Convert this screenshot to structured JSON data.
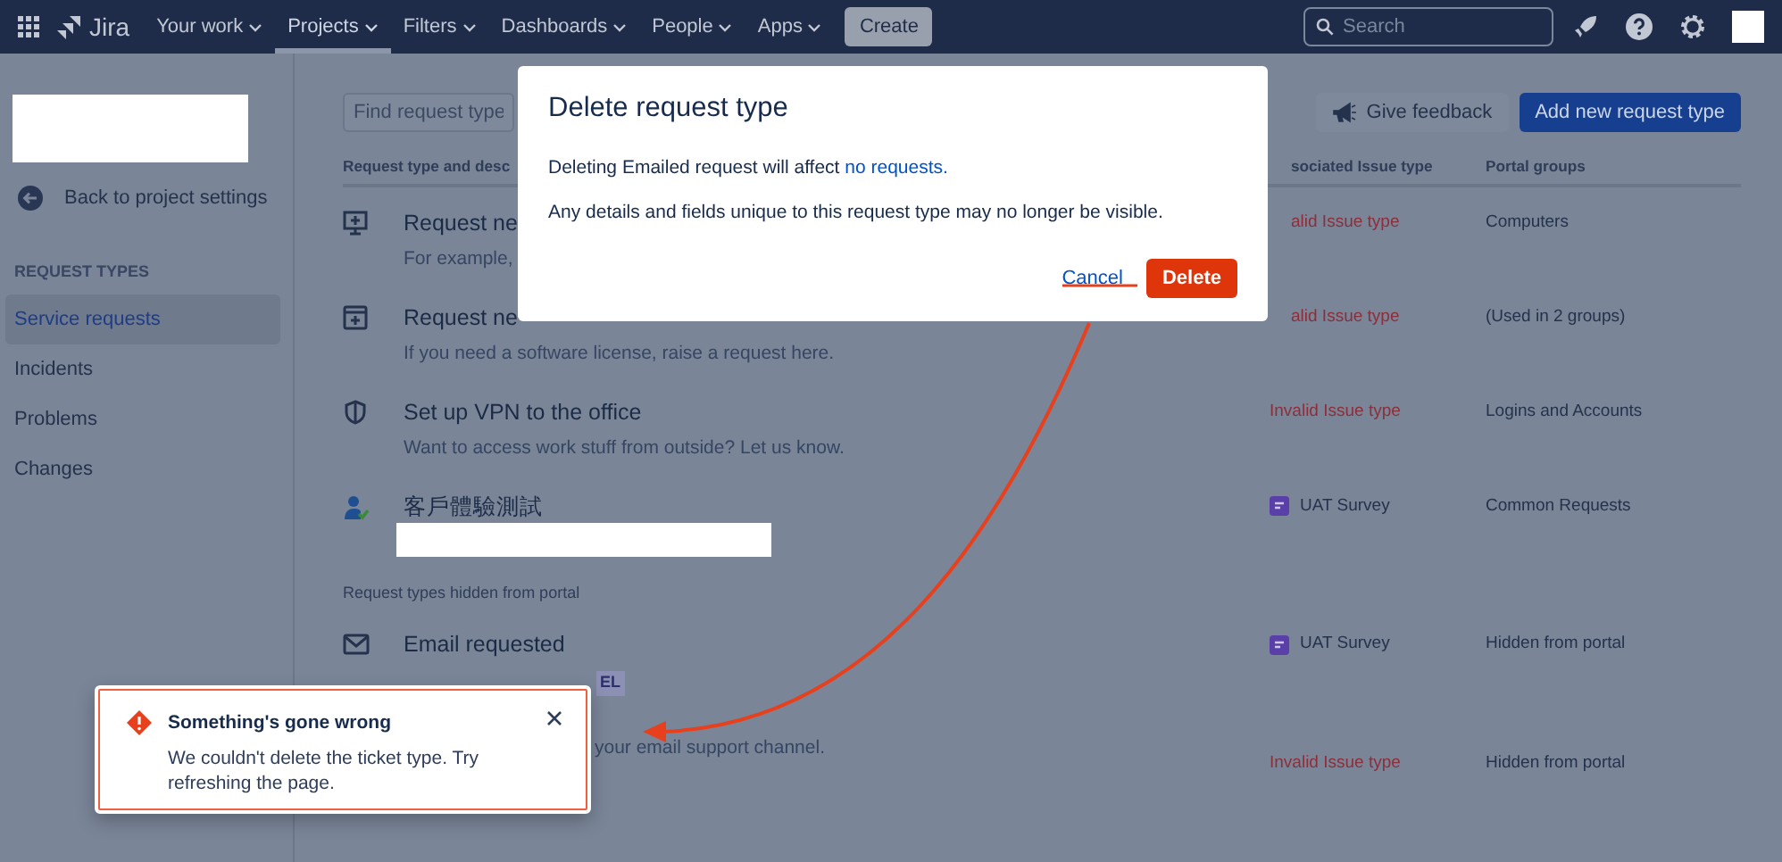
{
  "navbar": {
    "product": "Jira",
    "items": [
      {
        "label": "Your work",
        "selected": false
      },
      {
        "label": "Projects",
        "selected": true
      },
      {
        "label": "Filters",
        "selected": false
      },
      {
        "label": "Dashboards",
        "selected": false
      },
      {
        "label": "People",
        "selected": false
      },
      {
        "label": "Apps",
        "selected": false
      }
    ],
    "create_button": "Create",
    "search": {
      "placeholder": "Search"
    }
  },
  "sidebar": {
    "back_link": "Back to project settings",
    "section_title": "REQUEST TYPES",
    "items": [
      {
        "label": "Service requests",
        "selected": true
      },
      {
        "label": "Incidents",
        "selected": false
      },
      {
        "label": "Problems",
        "selected": false
      },
      {
        "label": "Changes",
        "selected": false
      }
    ]
  },
  "toolbar": {
    "search": {
      "placeholder": "Find request type"
    },
    "buttons": [
      {
        "label": "Give feedback",
        "kind": "subtle"
      },
      {
        "label": "Add new request type",
        "kind": "primary"
      }
    ]
  },
  "table": {
    "columns": [
      "Request type and desc",
      "sociated Issue type",
      "Portal groups"
    ],
    "rows": [
      {
        "kind": "monitor",
        "title": "Request ne",
        "description": "For example,",
        "redacted": false,
        "issue_type": "alid Issue type",
        "issue_invalid": true,
        "portal_group": "Computers"
      },
      {
        "kind": "window",
        "title": "Request ne",
        "description": "If you need a software license, raise a request here.",
        "redacted": false,
        "issue_type": "alid Issue type",
        "issue_invalid": true,
        "portal_group": "(Used in 2 groups)"
      },
      {
        "kind": "shield",
        "title": "Set up VPN to the office",
        "description": "Want to access work stuff from outside? Let us know.",
        "redacted": false,
        "issue_type": "Invalid Issue type",
        "issue_invalid": true,
        "portal_group": "Logins and Accounts"
      },
      {
        "kind": "person",
        "title": "客戶體驗測試",
        "redacted": true,
        "issue_type": "UAT Survey",
        "issue_invalid": false,
        "portal_group": "Common Requests"
      }
    ]
  },
  "hidden_section": {
    "label": "Request types hidden from portal",
    "rows": [
      {
        "kind": "email",
        "title": "Email requested",
        "lozenge": "EL",
        "issue_type": "UAT Survey",
        "issue_invalid": false,
        "portal_group": "Hidden from portal"
      },
      {
        "kind": "none",
        "description": "your email support channel.",
        "issue_type": "Invalid Issue type",
        "issue_invalid": true,
        "portal_group": "Hidden from portal"
      }
    ]
  },
  "modal": {
    "title": "Delete request type",
    "message": "Deleting Emailed request will affect",
    "message_link": "no requests.",
    "note": "Any details and fields unique to this request type may no longer be visible.",
    "buttons": [
      {
        "label": "Cancel",
        "kind": "link"
      },
      {
        "label": "Delete",
        "kind": "danger"
      }
    ]
  },
  "toast": {
    "title": "Something's gone wrong",
    "message": "We couldn't delete the ticket type. Try refreshing the page."
  }
}
